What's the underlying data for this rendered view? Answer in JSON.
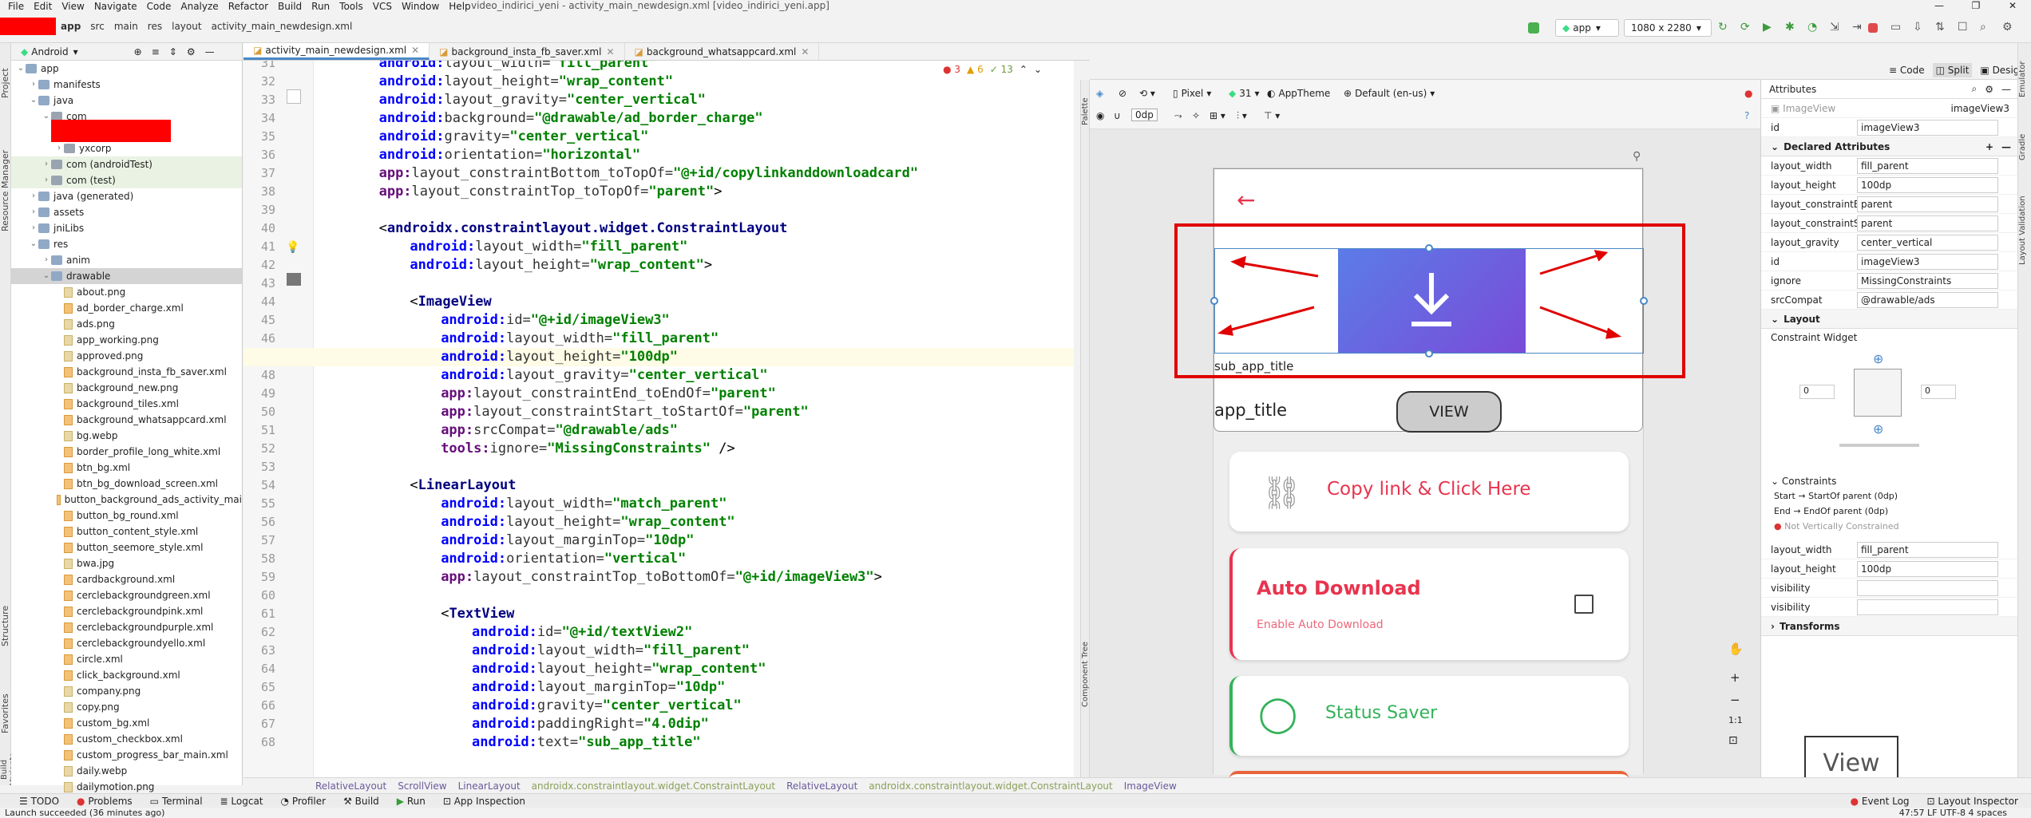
{
  "menu": [
    "File",
    "Edit",
    "View",
    "Navigate",
    "Code",
    "Analyze",
    "Refactor",
    "Build",
    "Run",
    "Tools",
    "VCS",
    "Window",
    "Help"
  ],
  "window_title": "video_indirici_yeni - activity_main_newdesign.xml [video_indirici_yeni.app]",
  "breadcrumb": [
    "app",
    "src",
    "main",
    "res",
    "layout",
    "activity_main_newdesign.xml"
  ],
  "run_config": "app",
  "device": "1080 x 2280",
  "project": {
    "selector": "Android",
    "tree": [
      {
        "d": 0,
        "o": "v",
        "icon": "folder",
        "t": "app"
      },
      {
        "d": 1,
        "o": ">",
        "icon": "folder",
        "t": "manifests"
      },
      {
        "d": 1,
        "o": "v",
        "icon": "folder",
        "t": "java"
      },
      {
        "d": 2,
        "o": "v",
        "icon": "folderg",
        "t": "com"
      },
      {
        "d": 3,
        "o": "",
        "icon": "folderg",
        "t": ""
      },
      {
        "d": 3,
        "o": ">",
        "icon": "folderg",
        "t": "yxcorp"
      },
      {
        "d": 2,
        "o": ">",
        "icon": "folderg",
        "t": "com (androidTest)",
        "g": 1
      },
      {
        "d": 2,
        "o": ">",
        "icon": "folderg",
        "t": "com (test)",
        "g": 1
      },
      {
        "d": 1,
        "o": ">",
        "icon": "folder",
        "t": "java (generated)"
      },
      {
        "d": 1,
        "o": ">",
        "icon": "folder",
        "t": "assets"
      },
      {
        "d": 1,
        "o": ">",
        "icon": "folder",
        "t": "jniLibs"
      },
      {
        "d": 1,
        "o": "v",
        "icon": "folder",
        "t": "res"
      },
      {
        "d": 2,
        "o": ">",
        "icon": "folder",
        "t": "anim"
      },
      {
        "d": 2,
        "o": "v",
        "icon": "folder",
        "t": "drawable",
        "s": 1
      },
      {
        "d": 3,
        "icon": "file",
        "t": "about.png"
      },
      {
        "d": 3,
        "icon": "xml",
        "t": "ad_border_charge.xml"
      },
      {
        "d": 3,
        "icon": "file",
        "t": "ads.png"
      },
      {
        "d": 3,
        "icon": "file",
        "t": "app_working.png"
      },
      {
        "d": 3,
        "icon": "file",
        "t": "approved.png"
      },
      {
        "d": 3,
        "icon": "xml",
        "t": "background_insta_fb_saver.xml"
      },
      {
        "d": 3,
        "icon": "file",
        "t": "background_new.png"
      },
      {
        "d": 3,
        "icon": "xml",
        "t": "background_tiles.xml"
      },
      {
        "d": 3,
        "icon": "xml",
        "t": "background_whatsappcard.xml"
      },
      {
        "d": 3,
        "icon": "file",
        "t": "bg.webp"
      },
      {
        "d": 3,
        "icon": "xml",
        "t": "border_profile_long_white.xml"
      },
      {
        "d": 3,
        "icon": "xml",
        "t": "btn_bg.xml"
      },
      {
        "d": 3,
        "icon": "xml",
        "t": "btn_bg_download_screen.xml"
      },
      {
        "d": 3,
        "icon": "xml",
        "t": "button_background_ads_activity_mai"
      },
      {
        "d": 3,
        "icon": "xml",
        "t": "button_bg_round.xml"
      },
      {
        "d": 3,
        "icon": "xml",
        "t": "button_content_style.xml"
      },
      {
        "d": 3,
        "icon": "xml",
        "t": "button_seemore_style.xml"
      },
      {
        "d": 3,
        "icon": "file",
        "t": "bwa.jpg"
      },
      {
        "d": 3,
        "icon": "xml",
        "t": "cardbackground.xml"
      },
      {
        "d": 3,
        "icon": "xml",
        "t": "cerclebackgroundgreen.xml"
      },
      {
        "d": 3,
        "icon": "xml",
        "t": "cerclebackgroundpink.xml"
      },
      {
        "d": 3,
        "icon": "xml",
        "t": "cerclebackgroundpurple.xml"
      },
      {
        "d": 3,
        "icon": "xml",
        "t": "cerclebackgroundyello.xml"
      },
      {
        "d": 3,
        "icon": "xml",
        "t": "circle.xml"
      },
      {
        "d": 3,
        "icon": "xml",
        "t": "click_background.xml"
      },
      {
        "d": 3,
        "icon": "file",
        "t": "company.png"
      },
      {
        "d": 3,
        "icon": "file",
        "t": "copy.png"
      },
      {
        "d": 3,
        "icon": "xml",
        "t": "custom_bg.xml"
      },
      {
        "d": 3,
        "icon": "xml",
        "t": "custom_checkbox.xml"
      },
      {
        "d": 3,
        "icon": "xml",
        "t": "custom_progress_bar_main.xml"
      },
      {
        "d": 3,
        "icon": "file",
        "t": "daily.webp"
      },
      {
        "d": 3,
        "icon": "file",
        "t": "dailymotion.png"
      }
    ]
  },
  "tabs": [
    "activity_main_newdesign.xml",
    "background_insta_fb_saver.xml",
    "background_whatsappcard.xml"
  ],
  "inspections": {
    "errors": "3",
    "warnings": "6",
    "weak": "13"
  },
  "code": [
    {
      "n": "31",
      "i": 8,
      "p": [
        [
          "attr",
          "android:"
        ],
        [
          "attrb",
          "layout_width="
        ],
        [
          "str",
          "\"fill_parent\""
        ]
      ]
    },
    {
      "n": "32",
      "i": 8,
      "p": [
        [
          "attr",
          "android:"
        ],
        [
          "attrb",
          "layout_height="
        ],
        [
          "str",
          "\"wrap_content\""
        ]
      ]
    },
    {
      "n": "33",
      "i": 8,
      "p": [
        [
          "attr",
          "android:"
        ],
        [
          "attrb",
          "layout_gravity="
        ],
        [
          "str",
          "\"center_vertical\""
        ]
      ]
    },
    {
      "n": "34",
      "i": 8,
      "p": [
        [
          "attr",
          "android:"
        ],
        [
          "attrb",
          "background="
        ],
        [
          "str",
          "\"@drawable/ad_border_charge\""
        ]
      ]
    },
    {
      "n": "35",
      "i": 8,
      "p": [
        [
          "attr",
          "android:"
        ],
        [
          "attrb",
          "gravity="
        ],
        [
          "str",
          "\"center_vertical\""
        ]
      ]
    },
    {
      "n": "36",
      "i": 8,
      "p": [
        [
          "attr",
          "android:"
        ],
        [
          "attrb",
          "orientation="
        ],
        [
          "str",
          "\"horizontal\""
        ]
      ]
    },
    {
      "n": "37",
      "i": 8,
      "p": [
        [
          "ns",
          "app:"
        ],
        [
          "attrb",
          "layout_constraintBottom_toTopOf="
        ],
        [
          "str",
          "\"@+id/copylinkanddownloadcard\""
        ]
      ]
    },
    {
      "n": "38",
      "i": 8,
      "p": [
        [
          "ns",
          "app:"
        ],
        [
          "attrb",
          "layout_constraintTop_toTopOf="
        ],
        [
          "str",
          "\"parent\""
        ],
        [
          "txtc",
          ">"
        ]
      ]
    },
    {
      "n": "39",
      "i": 0,
      "p": []
    },
    {
      "n": "40",
      "i": 8,
      "p": [
        [
          "txtc",
          "<"
        ],
        [
          "tagc",
          "androidx.constraintlayout.widget.ConstraintLayout"
        ]
      ]
    },
    {
      "n": "41",
      "i": 12,
      "p": [
        [
          "attr",
          "android:"
        ],
        [
          "attrb",
          "layout_width="
        ],
        [
          "str",
          "\"fill_parent\""
        ]
      ]
    },
    {
      "n": "42",
      "i": 12,
      "p": [
        [
          "attr",
          "android:"
        ],
        [
          "attrb",
          "layout_height="
        ],
        [
          "str",
          "\"wrap_content\""
        ],
        [
          "txtc",
          ">"
        ]
      ]
    },
    {
      "n": "43",
      "i": 0,
      "p": []
    },
    {
      "n": "44",
      "i": 12,
      "p": [
        [
          "txtc",
          "<"
        ],
        [
          "tagc",
          "ImageView"
        ]
      ]
    },
    {
      "n": "45",
      "i": 16,
      "p": [
        [
          "attr",
          "android:"
        ],
        [
          "attrb",
          "id="
        ],
        [
          "str",
          "\"@+id/imageView3\""
        ]
      ]
    },
    {
      "n": "46",
      "i": 16,
      "p": [
        [
          "attr",
          "android:"
        ],
        [
          "attrb",
          "layout_width="
        ],
        [
          "str",
          "\"fill_parent\""
        ]
      ]
    },
    {
      "n": "47",
      "i": 16,
      "p": [
        [
          "attr",
          "android:"
        ],
        [
          "attrb",
          "layout_height="
        ],
        [
          "str",
          "\"100dp\""
        ]
      ],
      "hl": 1
    },
    {
      "n": "48",
      "i": 16,
      "p": [
        [
          "attr",
          "android:"
        ],
        [
          "attrb",
          "layout_gravity="
        ],
        [
          "str",
          "\"center_vertical\""
        ]
      ]
    },
    {
      "n": "49",
      "i": 16,
      "p": [
        [
          "ns",
          "app:"
        ],
        [
          "attrb",
          "layout_constraintEnd_toEndOf="
        ],
        [
          "str",
          "\"parent\""
        ]
      ]
    },
    {
      "n": "50",
      "i": 16,
      "p": [
        [
          "ns",
          "app:"
        ],
        [
          "attrb",
          "layout_constraintStart_toStartOf="
        ],
        [
          "str",
          "\"parent\""
        ]
      ]
    },
    {
      "n": "51",
      "i": 16,
      "p": [
        [
          "ns",
          "app:"
        ],
        [
          "attrb",
          "srcCompat="
        ],
        [
          "str",
          "\"@drawable/ads\""
        ]
      ]
    },
    {
      "n": "52",
      "i": 16,
      "p": [
        [
          "ns",
          "tools:"
        ],
        [
          "attrb",
          "ignore="
        ],
        [
          "str",
          "\"MissingConstraints\""
        ],
        [
          "txtc",
          " />"
        ]
      ]
    },
    {
      "n": "53",
      "i": 0,
      "p": []
    },
    {
      "n": "54",
      "i": 12,
      "p": [
        [
          "txtc",
          "<"
        ],
        [
          "tagc",
          "LinearLayout"
        ]
      ]
    },
    {
      "n": "55",
      "i": 16,
      "p": [
        [
          "attr",
          "android:"
        ],
        [
          "attrb",
          "layout_width="
        ],
        [
          "str",
          "\"match_parent\""
        ]
      ]
    },
    {
      "n": "56",
      "i": 16,
      "p": [
        [
          "attr",
          "android:"
        ],
        [
          "attrb",
          "layout_height="
        ],
        [
          "str",
          "\"wrap_content\""
        ]
      ]
    },
    {
      "n": "57",
      "i": 16,
      "p": [
        [
          "attr",
          "android:"
        ],
        [
          "attrb",
          "layout_marginTop="
        ],
        [
          "str",
          "\"10dp\""
        ]
      ]
    },
    {
      "n": "58",
      "i": 16,
      "p": [
        [
          "attr",
          "android:"
        ],
        [
          "attrb",
          "orientation="
        ],
        [
          "str",
          "\"vertical\""
        ]
      ]
    },
    {
      "n": "59",
      "i": 16,
      "p": [
        [
          "ns",
          "app:"
        ],
        [
          "attrb",
          "layout_constraintTop_toBottomOf="
        ],
        [
          "str",
          "\"@+id/imageView3\""
        ],
        [
          "txtc",
          ">"
        ]
      ]
    },
    {
      "n": "60",
      "i": 0,
      "p": []
    },
    {
      "n": "61",
      "i": 16,
      "p": [
        [
          "txtc",
          "<"
        ],
        [
          "tagc",
          "TextView"
        ]
      ]
    },
    {
      "n": "62",
      "i": 20,
      "p": [
        [
          "attr",
          "android:"
        ],
        [
          "attrb",
          "id="
        ],
        [
          "str",
          "\"@+id/textView2\""
        ]
      ]
    },
    {
      "n": "63",
      "i": 20,
      "p": [
        [
          "attr",
          "android:"
        ],
        [
          "attrb",
          "layout_width="
        ],
        [
          "str",
          "\"fill_parent\""
        ]
      ]
    },
    {
      "n": "64",
      "i": 20,
      "p": [
        [
          "attr",
          "android:"
        ],
        [
          "attrb",
          "layout_height="
        ],
        [
          "str",
          "\"wrap_content\""
        ]
      ]
    },
    {
      "n": "65",
      "i": 20,
      "p": [
        [
          "attr",
          "android:"
        ],
        [
          "attrb",
          "layout_marginTop="
        ],
        [
          "str",
          "\"10dp\""
        ]
      ]
    },
    {
      "n": "66",
      "i": 20,
      "p": [
        [
          "attr",
          "android:"
        ],
        [
          "attrb",
          "gravity="
        ],
        [
          "str",
          "\"center_vertical\""
        ]
      ]
    },
    {
      "n": "67",
      "i": 20,
      "p": [
        [
          "attr",
          "android:"
        ],
        [
          "attrb",
          "paddingRight="
        ],
        [
          "str",
          "\"4.0dip\""
        ]
      ]
    },
    {
      "n": "68",
      "i": 20,
      "p": [
        [
          "attr",
          "android:"
        ],
        [
          "attrb",
          "text="
        ],
        [
          "str",
          "\"sub_app_title\""
        ]
      ]
    }
  ],
  "view_modes": [
    "Code",
    "Split",
    "Design"
  ],
  "design_toolbar": {
    "device": "Pixel",
    "api": "31",
    "theme": "AppTheme",
    "locale": "Default (en-us)",
    "margin": "0dp"
  },
  "preview": {
    "sub_title": "sub_app_title",
    "title": "app_title",
    "view_btn": "VIEW",
    "copy_link": "Copy link & Click Here",
    "auto_download": "Auto Download",
    "enable_auto": "Enable Auto Download",
    "status_saver": "Status Saver"
  },
  "attributes": {
    "title": "Attributes",
    "type": "ImageView",
    "type_right": "imageView3",
    "id_label": "id",
    "id_value": "imageView3",
    "declared_title": "Declared Attributes",
    "declared": [
      [
        "layout_width",
        "fill_parent"
      ],
      [
        "layout_height",
        "100dp"
      ],
      [
        "layout_constraintE...",
        "parent"
      ],
      [
        "layout_constraintSt...",
        "parent"
      ],
      [
        "layout_gravity",
        "center_vertical"
      ],
      [
        "id",
        "imageView3"
      ],
      [
        "ignore",
        "MissingConstraints"
      ],
      [
        "srcCompat",
        "@drawable/ads"
      ]
    ],
    "layout_title": "Layout",
    "constraint_widget": "Constraint Widget",
    "left_margin": "0",
    "right_margin": "0",
    "constraints_title": "Constraints",
    "constraints": [
      "Start → StartOf parent (0dp)",
      "End → EndOf parent (0dp)",
      "Not Vertically Constrained"
    ],
    "layout_attrs": [
      [
        "layout_width",
        "fill_parent"
      ],
      [
        "layout_height",
        "100dp"
      ],
      [
        "visibility",
        ""
      ],
      [
        "visibility",
        ""
      ]
    ],
    "transforms_title": "Transforms",
    "view_preview": "View"
  },
  "component_tree": "Component Tree",
  "palette": "Palette",
  "breadcrumbs_bottom": [
    "RelativeLayout",
    "ScrollView",
    "LinearLayout",
    "androidx.constraintlayout.widget.ConstraintLayout",
    "RelativeLayout",
    "androidx.constraintlayout.widget.ConstraintLayout",
    "ImageView"
  ],
  "bottom_tabs": [
    "TODO",
    "Problems",
    "Terminal",
    "Logcat",
    "Profiler",
    "Build",
    "Run",
    "App Inspection"
  ],
  "bottom_right": [
    "Event Log",
    "Layout Inspector"
  ],
  "status": "Launch succeeded (36 minutes ago)",
  "status_right": "47:57   LF   UTF-8   4 spaces",
  "left_tabs": [
    "Project",
    "Resource Manager",
    "Structure",
    "Favorites",
    "Build Variants"
  ],
  "right_tabs": [
    "Emulator",
    "Gradle",
    "Layout Validation"
  ],
  "colors": {
    "accent": "#4a88c7",
    "red": "#e00000",
    "pink": "#e8344e",
    "green": "#33b25a"
  }
}
